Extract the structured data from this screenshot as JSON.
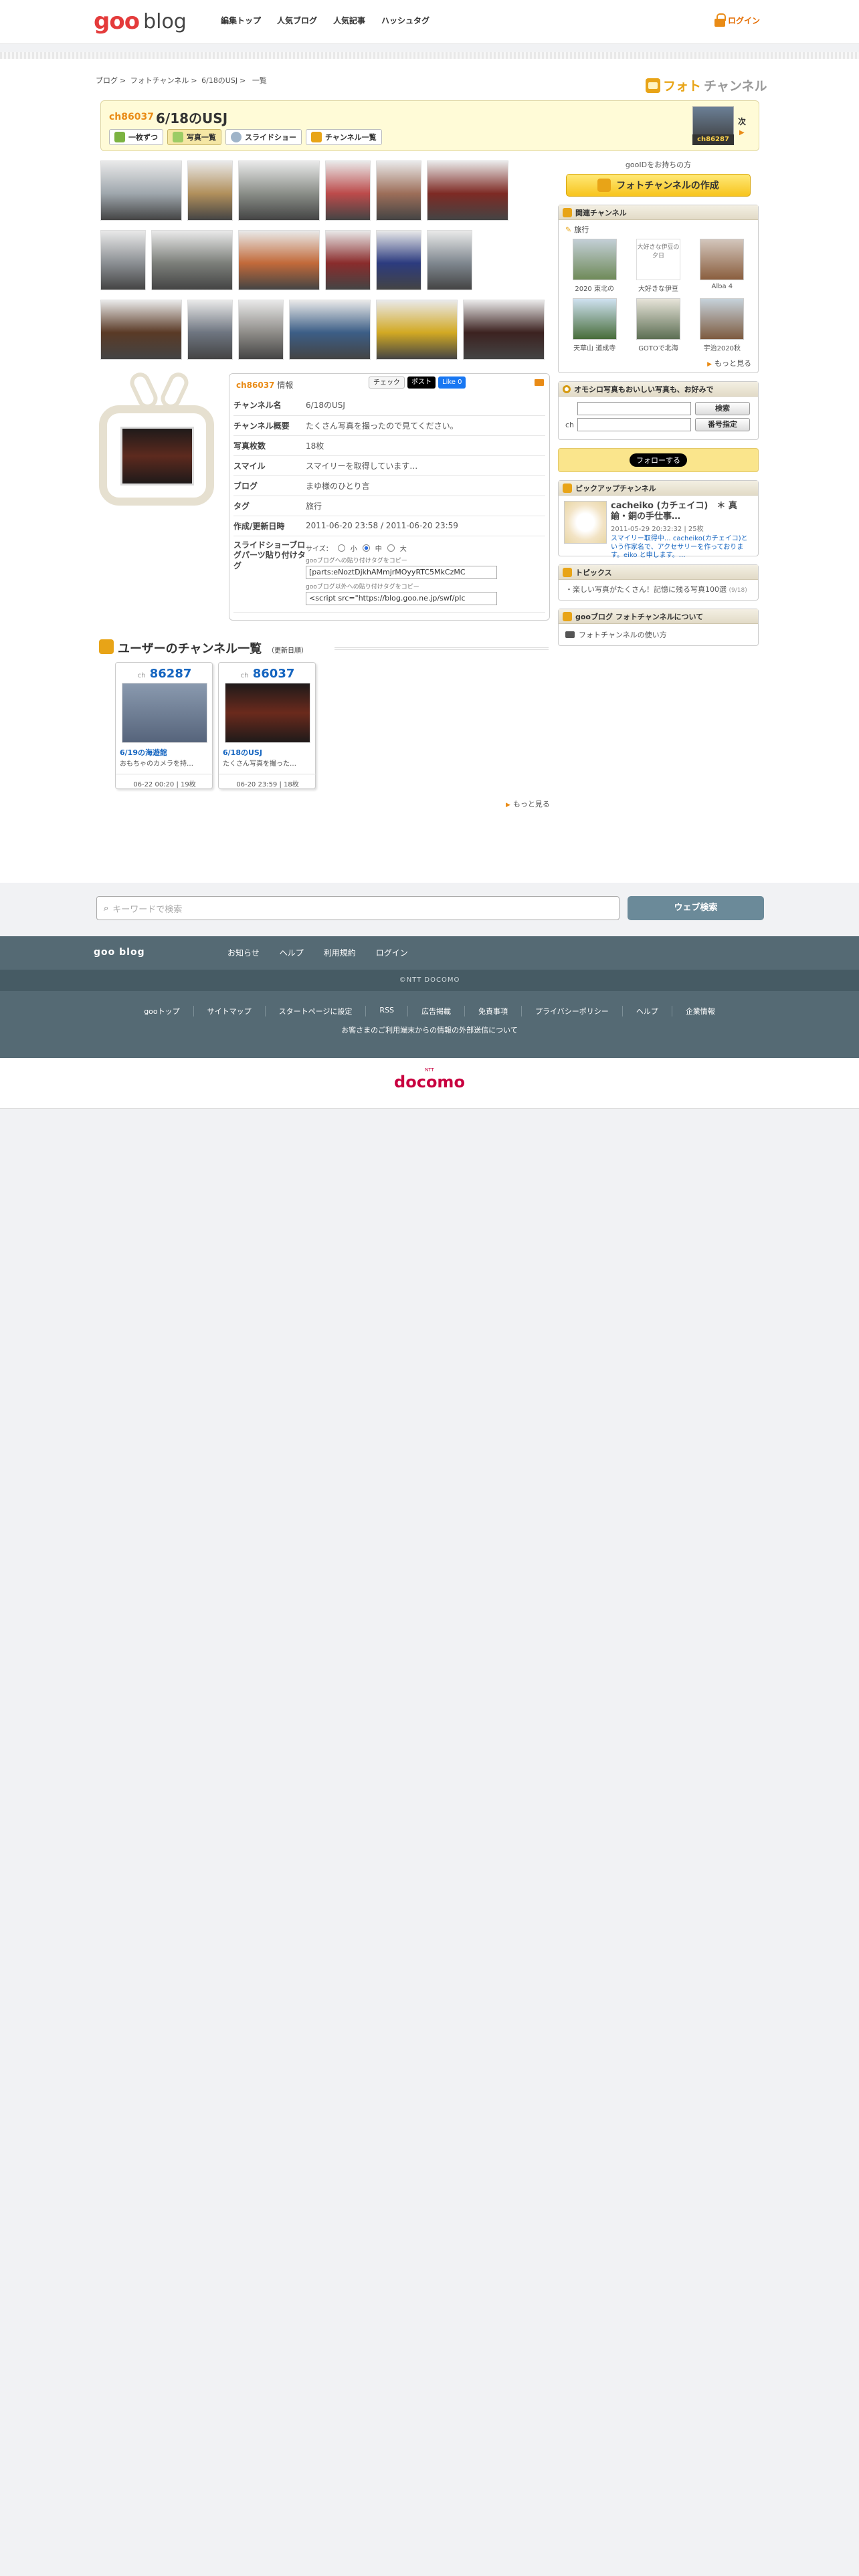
{
  "header": {
    "logo_goo": "goo",
    "logo_blog": "blog",
    "nav": [
      "編集トップ",
      "人気ブログ",
      "人気記事",
      "ハッシュタグ"
    ],
    "login": "ログイン"
  },
  "breadcrumb": [
    "ブログ",
    "フォトチャンネル",
    "6/18のUSJ",
    "一覧"
  ],
  "brand_logo": {
    "part1": "フォト",
    "part2": "チャンネル"
  },
  "channel": {
    "no": "ch86037",
    "title": "6/18のUSJ",
    "tabs": [
      "一枚ずつ",
      "写真一覧",
      "スライドショー",
      "チャンネル一覧"
    ],
    "next_label": "次",
    "next_badge": "ch86287"
  },
  "photo_colors": [
    [
      "#9fa7ad",
      "#b1905c",
      "#8a8e88",
      "#bc4b4b",
      "#9d6e59",
      "#7e2a24"
    ],
    [
      "#8b8f93",
      "#7c7f7a",
      "#c26a3a",
      "#8a2c2c",
      "#2c3b7f",
      "#7f878f"
    ],
    [
      "#5a3a26",
      "#6e7580",
      "#8e8c88",
      "#3c5e86",
      "#d2a923",
      "#3c2220"
    ]
  ],
  "info": {
    "head_no": "ch86037",
    "head_label": "情報",
    "social": [
      "チェック",
      "ポスト",
      "Like 0"
    ],
    "rows": [
      {
        "k": "チャンネル名",
        "v": "6/18のUSJ"
      },
      {
        "k": "チャンネル概要",
        "v": "たくさん写真を撮ったので見てください。"
      },
      {
        "k": "写真枚数",
        "v": "18枚"
      },
      {
        "k": "スマイル",
        "v": "スマイリーを取得しています…"
      },
      {
        "k": "ブログ",
        "v": "まゆ様のひとり言"
      },
      {
        "k": "タグ",
        "v": "旅行"
      },
      {
        "k": "作成/更新日時",
        "v": "2011-06-20 23:58 / 2011-06-20 23:59"
      }
    ],
    "embed_key": "スライドショーブログパーツ貼り付けタグ",
    "size_label": "サイズ：",
    "sizes": [
      "小",
      "中",
      "大"
    ],
    "note1": "gooブログへの貼り付けタグをコピー",
    "code1": "[parts:eNoztDjkhAMmjrMOyyRTC5MkCzMC",
    "note2": "gooブログ以外への貼り付けタグをコピー",
    "code2": "<script src=\"https://blog.goo.ne.jp/swf/plc"
  },
  "userlist": {
    "title": "ユーザーのチャンネル一覧",
    "sub": "（更新日順）",
    "cards": [
      {
        "ch": "ch",
        "no": "86287",
        "title": "6/19の海遊館",
        "desc": "おもちゃのカメラを持…",
        "foot": "06-22 00:20 | 19枚"
      },
      {
        "ch": "ch",
        "no": "86037",
        "title": "6/18のUSJ",
        "desc": "たくさん写真を撮った…",
        "foot": "06-20 23:59 | 18枚"
      }
    ],
    "more": "もっと見る"
  },
  "sidebar": {
    "goo_id": "gooIDをお持ちの方",
    "create_btn": "フォトチャンネルの作成",
    "related": {
      "title": "関連チャンネル",
      "tag": "旅行",
      "items": [
        "2020 東北の",
        "大好きな伊豆",
        "Alba 4",
        "天草山 道成寺",
        "GOTOで北海",
        "宇治2020秋"
      ],
      "img_alt": "大好きな伊豆の夕日",
      "more": "もっと見る"
    },
    "search": {
      "title": "オモシロ写真もおいしい写真も、お好みで",
      "btn1": "検索",
      "ch_label": "ch",
      "btn2": "番号指定"
    },
    "follow": "フォローする",
    "pickup": {
      "title": "ピックアップチャンネル",
      "name": "cacheiko (カチェイコ)　＊ 真鍮・銅の手仕事…",
      "date": "2011-05-29 20:32:32 | 25枚",
      "desc": "スマイリー取得中… cacheiko(カチェイコ)という作家名で、アクセサリーを作っております。eiko と申します。…"
    },
    "topics": {
      "title": "トピックス",
      "item": "楽しい写真がたくさん！記憶に残る写真100選",
      "item_sub": "(9/18)"
    },
    "about": {
      "title": "gooブログ フォトチャンネルについて",
      "link": "フォトチャンネルの使い方"
    }
  },
  "search_bar": {
    "placeholder": "キーワードで検索",
    "button": "ウェブ検索"
  },
  "footer": {
    "brand": "goo blog",
    "nav1": [
      "お知らせ",
      "ヘルプ",
      "利用規約",
      "ログイン"
    ],
    "copyright": "©NTT DOCOMO",
    "nav2": [
      "gooトップ",
      "サイトマップ",
      "スタートページに設定",
      "RSS",
      "広告掲載",
      "免責事項",
      "プライバシーポリシー",
      "ヘルプ",
      "企業情報"
    ],
    "note": "お客さまのご利用端末からの情報の外部送信について",
    "docomo": "docomo",
    "docomo_top": "NTT"
  }
}
